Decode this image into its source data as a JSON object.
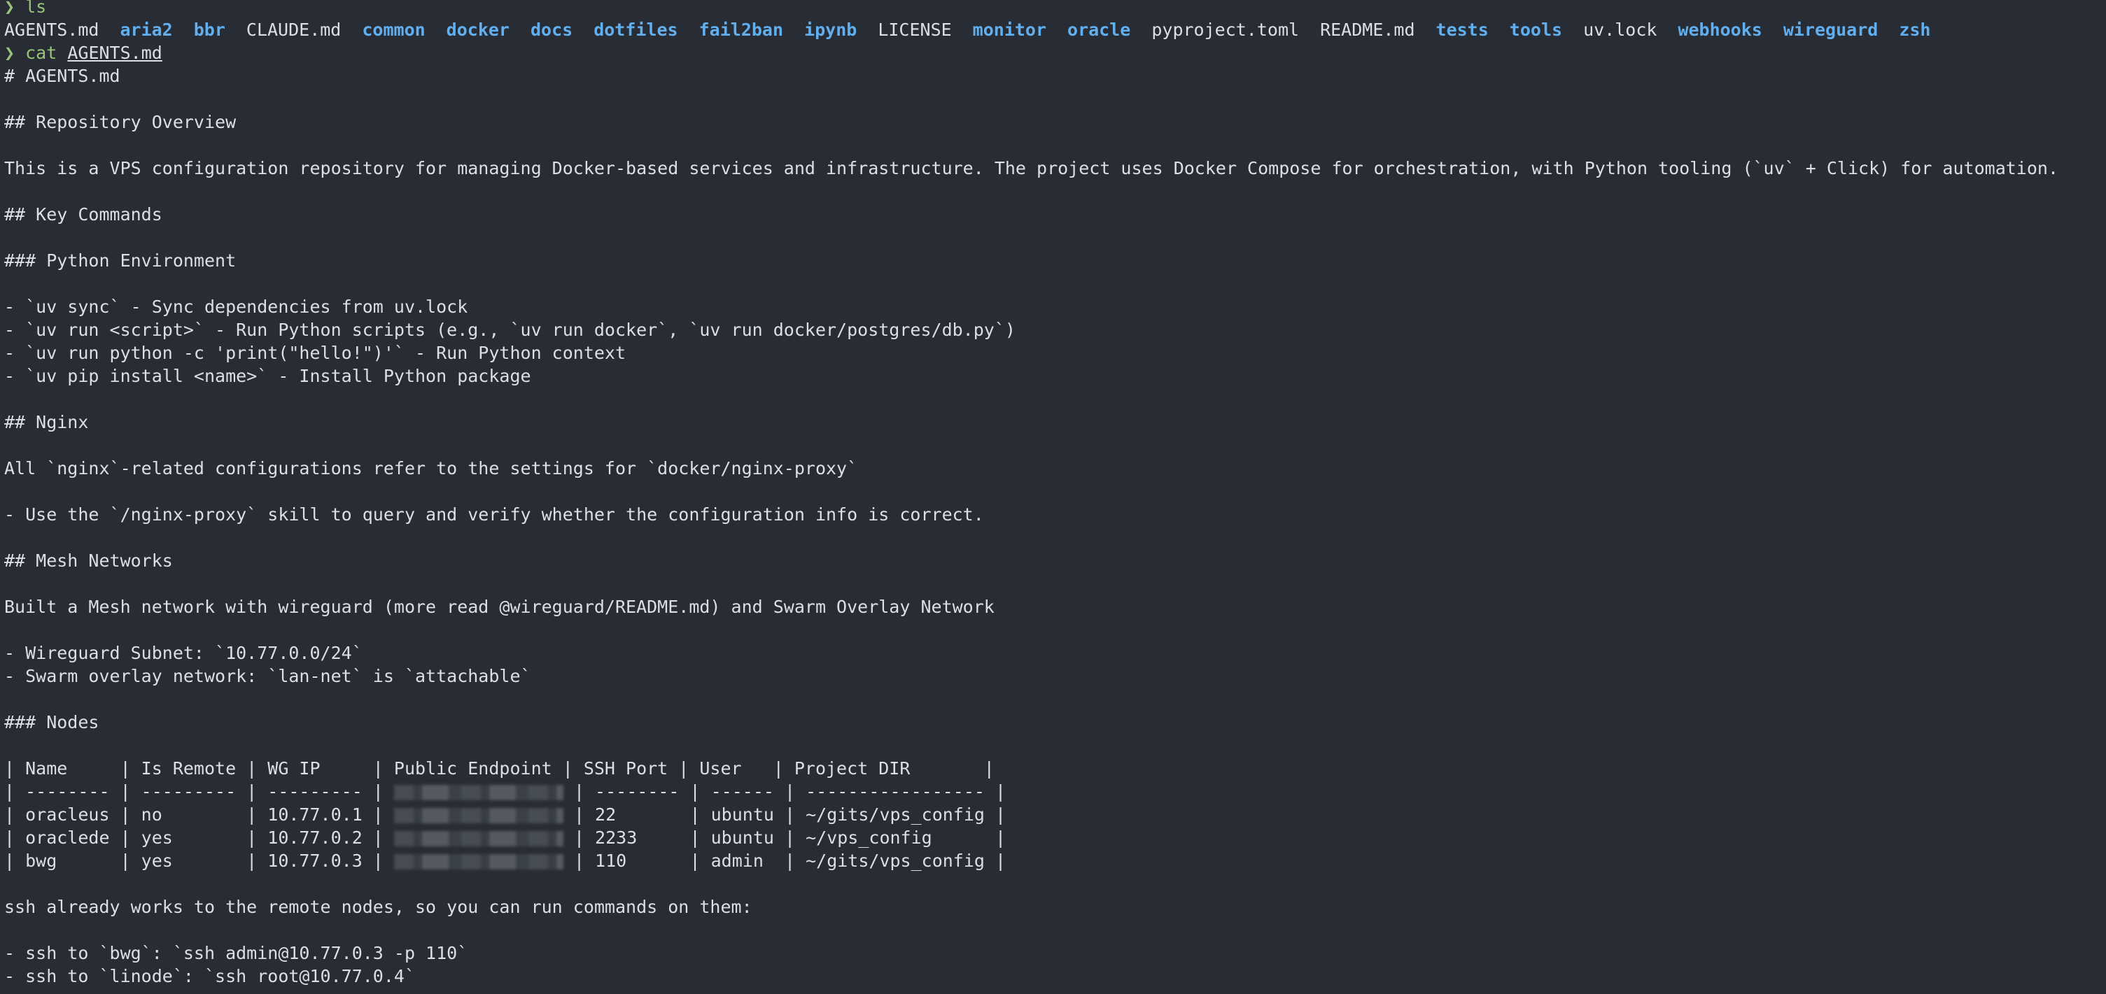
{
  "prompt": {
    "symbol": "❯",
    "ls_command": "ls",
    "cat_command": "cat",
    "cat_arg": "AGENTS.md"
  },
  "ls_entries": [
    {
      "name": "AGENTS.md",
      "type": "file"
    },
    {
      "name": "aria2",
      "type": "dir"
    },
    {
      "name": "bbr",
      "type": "dir"
    },
    {
      "name": "CLAUDE.md",
      "type": "file"
    },
    {
      "name": "common",
      "type": "dir"
    },
    {
      "name": "docker",
      "type": "dir"
    },
    {
      "name": "docs",
      "type": "dir"
    },
    {
      "name": "dotfiles",
      "type": "dir"
    },
    {
      "name": "fail2ban",
      "type": "dir"
    },
    {
      "name": "ipynb",
      "type": "dir"
    },
    {
      "name": "LICENSE",
      "type": "file"
    },
    {
      "name": "monitor",
      "type": "dir"
    },
    {
      "name": "oracle",
      "type": "dir"
    },
    {
      "name": "pyproject.toml",
      "type": "file"
    },
    {
      "name": "README.md",
      "type": "file"
    },
    {
      "name": "tests",
      "type": "dir"
    },
    {
      "name": "tools",
      "type": "dir"
    },
    {
      "name": "uv.lock",
      "type": "file"
    },
    {
      "name": "webhooks",
      "type": "dir"
    },
    {
      "name": "wireguard",
      "type": "dir"
    },
    {
      "name": "zsh",
      "type": "dir"
    }
  ],
  "doc": {
    "l01": "# AGENTS.md",
    "l02": "",
    "l03": "## Repository Overview",
    "l04": "",
    "l05": "This is a VPS configuration repository for managing Docker-based services and infrastructure. The project uses Docker Compose for orchestration, with Python tooling (`uv` + Click) for automation.",
    "l06": "",
    "l07": "## Key Commands",
    "l08": "",
    "l09": "### Python Environment",
    "l10": "",
    "l11": "- `uv sync` - Sync dependencies from uv.lock",
    "l12": "- `uv run <script>` - Run Python scripts (e.g., `uv run docker`, `uv run docker/postgres/db.py`)",
    "l13": "- `uv run python -c 'print(\"hello!\")'` - Run Python context",
    "l14": "- `uv pip install <name>` - Install Python package",
    "l15": "",
    "l16": "## Nginx",
    "l17": "",
    "l18": "All `nginx`-related configurations refer to the settings for `docker/nginx-proxy`",
    "l19": "",
    "l20": "- Use the `/nginx-proxy` skill to query and verify whether the configuration info is correct.",
    "l21": "",
    "l22": "## Mesh Networks",
    "l23": "",
    "l24": "Built a Mesh network with wireguard (more read @wireguard/README.md) and Swarm Overlay Network",
    "l25": "",
    "l26": "- Wireguard Subnet: `10.77.0.0/24`",
    "l27": "- Swarm overlay network: `lan-net` is `attachable`",
    "l28": "",
    "l29": "### Nodes",
    "l30": "",
    "table_header": "| Name     | Is Remote | WG IP     | Public Endpoint | SSH Port | User   | Project DIR       |",
    "table_sep": "| -------- | --------- | --------- | ",
    "table_sep_tail": " | -------- | ------ | ----------------- |",
    "row1_pre": "| oracleus | no        | 10.77.0.1 | ",
    "row1_post": " | 22       | ubuntu | ~/gits/vps_config |",
    "row2_pre": "| oraclede | yes       | 10.77.0.2 | ",
    "row2_post": " | 2233     | ubuntu | ~/vps_config      |",
    "row3_pre": "| bwg      | yes       | 10.77.0.3 | ",
    "row3_post": " | 110      | admin  | ~/gits/vps_config |",
    "l35": "",
    "l36": "ssh already works to the remote nodes, so you can run commands on them:",
    "l37": "",
    "l38": "- ssh to `bwg`: `ssh admin@10.77.0.3 -p 110`",
    "l39": "- ssh to `linode`: `ssh root@10.77.0.4`"
  },
  "colors": {
    "background": "#282c34",
    "text": "#dcdfe4",
    "prompt": "#98c379",
    "directory": "#61afef"
  }
}
